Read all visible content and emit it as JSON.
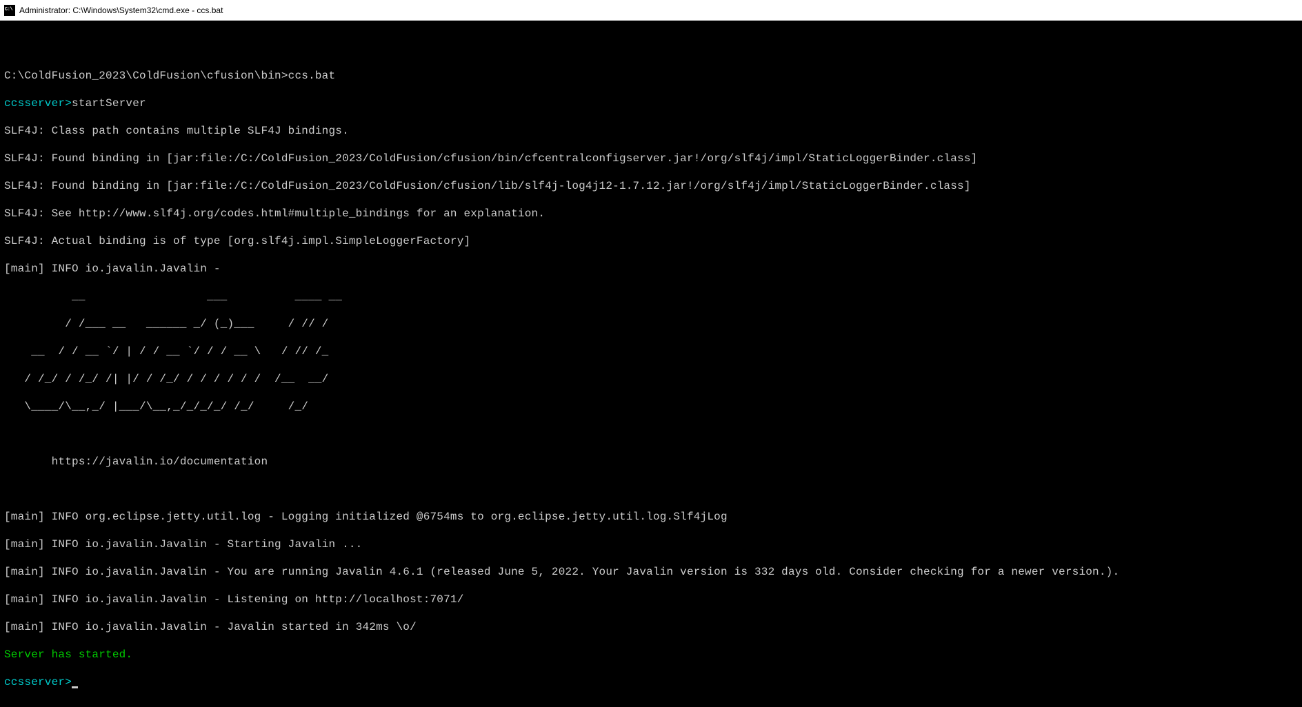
{
  "titlebar": {
    "text": "Administrator: C:\\Windows\\System32\\cmd.exe - ccs.bat"
  },
  "terminal": {
    "path_line": "C:\\ColdFusion_2023\\ColdFusion\\cfusion\\bin>ccs.bat",
    "prompt1": "ccsserver>",
    "command1": "startServer",
    "slf4j_1": "SLF4J: Class path contains multiple SLF4J bindings.",
    "slf4j_2": "SLF4J: Found binding in [jar:file:/C:/ColdFusion_2023/ColdFusion/cfusion/bin/cfcentralconfigserver.jar!/org/slf4j/impl/StaticLoggerBinder.class]",
    "slf4j_3": "SLF4J: Found binding in [jar:file:/C:/ColdFusion_2023/ColdFusion/cfusion/lib/slf4j-log4j12-1.7.12.jar!/org/slf4j/impl/StaticLoggerBinder.class]",
    "slf4j_4": "SLF4J: See http://www.slf4j.org/codes.html#multiple_bindings for an explanation.",
    "slf4j_5": "SLF4J: Actual binding is of type [org.slf4j.impl.SimpleLoggerFactory]",
    "javalin_info": "[main] INFO io.javalin.Javalin -",
    "ascii_1": "          __                  ___          ____ __",
    "ascii_2": "         / /___ __   ______ _/ (_)___     / // /",
    "ascii_3": "    __  / / __ `/ | / / __ `/ / / __ \\   / // /_",
    "ascii_4": "   / /_/ / /_/ /| |/ / /_/ / / / / / /  /__  __/",
    "ascii_5": "   \\____/\\__,_/ |___/\\__,_/_/_/_/ /_/     /_/",
    "doc_url": "       https://javalin.io/documentation",
    "log_1": "[main] INFO org.eclipse.jetty.util.log - Logging initialized @6754ms to org.eclipse.jetty.util.log.Slf4jLog",
    "log_2": "[main] INFO io.javalin.Javalin - Starting Javalin ...",
    "log_3": "[main] INFO io.javalin.Javalin - You are running Javalin 4.6.1 (released June 5, 2022. Your Javalin version is 332 days old. Consider checking for a newer version.).",
    "log_4": "[main] INFO io.javalin.Javalin - Listening on http://localhost:7071/",
    "log_5": "[main] INFO io.javalin.Javalin - Javalin started in 342ms \\o/",
    "server_started": "Server has started.",
    "prompt2": "ccsserver>"
  }
}
